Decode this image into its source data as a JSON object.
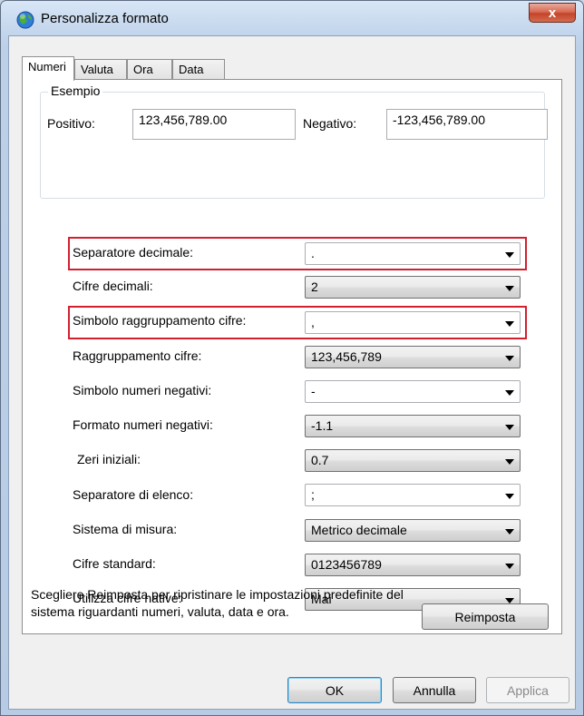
{
  "window": {
    "title": "Personalizza formato",
    "close_label": "x"
  },
  "tabs": [
    {
      "label": "Numeri",
      "active": true
    },
    {
      "label": "Valuta",
      "active": false
    },
    {
      "label": "Ora",
      "active": false
    },
    {
      "label": "Data",
      "active": false
    }
  ],
  "example": {
    "legend": "Esempio",
    "positive_label": "Positivo:",
    "positive_value": "123,456,789.00",
    "negative_label": "Negativo:",
    "negative_value": "-123,456,789.00"
  },
  "settings": [
    {
      "label": "Separatore decimale:",
      "value": ".",
      "kind": "editable",
      "highlighted": true
    },
    {
      "label": "Cifre decimali:",
      "value": "2",
      "kind": "dropdown",
      "highlighted": false
    },
    {
      "label": "Simbolo raggruppamento cifre:",
      "value": ",",
      "kind": "editable",
      "highlighted": true
    },
    {
      "label": "Raggruppamento cifre:",
      "value": "123,456,789",
      "kind": "dropdown",
      "highlighted": false
    },
    {
      "label": "Simbolo numeri negativi:",
      "value": "-",
      "kind": "editable",
      "highlighted": false
    },
    {
      "label": "Formato numeri negativi:",
      "value": "-1.1",
      "kind": "dropdown",
      "highlighted": false
    },
    {
      "label": "Zeri iniziali:",
      "value": "0.7",
      "kind": "dropdown",
      "highlighted": false
    },
    {
      "label": "Separatore di elenco:",
      "value": ";",
      "kind": "editable",
      "highlighted": false
    },
    {
      "label": "Sistema di misura:",
      "value": "Metrico decimale",
      "kind": "dropdown",
      "highlighted": false
    },
    {
      "label": "Cifre standard:",
      "value": "0123456789",
      "kind": "dropdown",
      "highlighted": false
    },
    {
      "label": "Utilizza cifre native:",
      "value": "Mai",
      "kind": "dropdown",
      "highlighted": false
    }
  ],
  "reset": {
    "description": "Scegliere Reimposta per ripristinare le impostazioni predefinite del sistema riguardanti numeri, valuta, data e ora.",
    "button_label": "Reimposta"
  },
  "buttons": {
    "ok": "OK",
    "cancel": "Annulla",
    "apply": "Applica"
  },
  "colors": {
    "highlight": "#d3202f",
    "close_button": "#c4442a"
  }
}
